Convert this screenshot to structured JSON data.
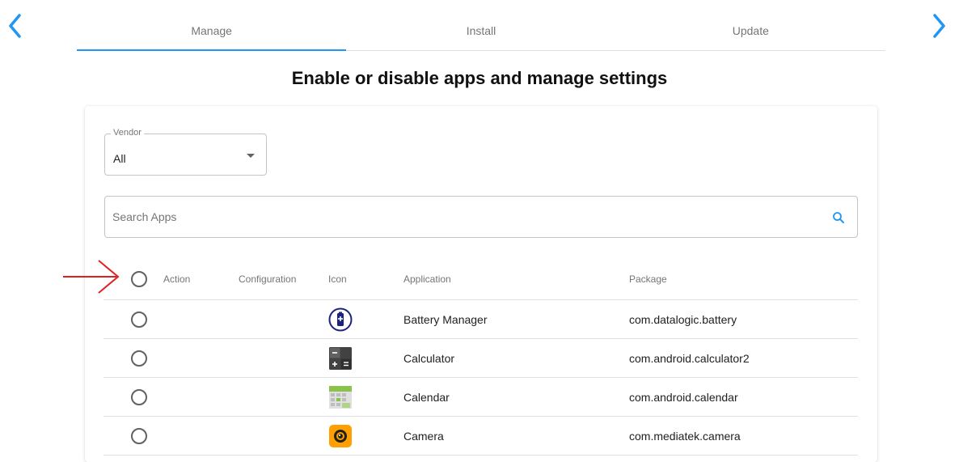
{
  "nav": {
    "prev_icon": "chevron-left-icon",
    "next_icon": "chevron-right-icon",
    "arrow_color": "#2196f3"
  },
  "tabs": [
    {
      "label": "Manage",
      "active": true
    },
    {
      "label": "Install",
      "active": false
    },
    {
      "label": "Update",
      "active": false
    }
  ],
  "page_title": "Enable or disable apps and manage settings",
  "vendor": {
    "label": "Vendor",
    "value": "All"
  },
  "search": {
    "placeholder": "Search Apps",
    "value": "",
    "icon": "search-icon"
  },
  "table": {
    "headers": {
      "action": "Action",
      "configuration": "Configuration",
      "icon": "Icon",
      "application": "Application",
      "package": "Package"
    },
    "rows": [
      {
        "icon": "battery-manager-icon",
        "application": "Battery Manager",
        "package": "com.datalogic.battery",
        "selected": false
      },
      {
        "icon": "calculator-icon",
        "application": "Calculator",
        "package": "com.android.calculator2",
        "selected": false
      },
      {
        "icon": "calendar-icon",
        "application": "Calendar",
        "package": "com.android.calendar",
        "selected": false
      },
      {
        "icon": "camera-icon",
        "application": "Camera",
        "package": "com.mediatek.camera",
        "selected": false
      }
    ]
  },
  "annotation": {
    "icon": "red-arrow-icon",
    "color": "#e02020"
  },
  "accent_color": "#2196f3"
}
